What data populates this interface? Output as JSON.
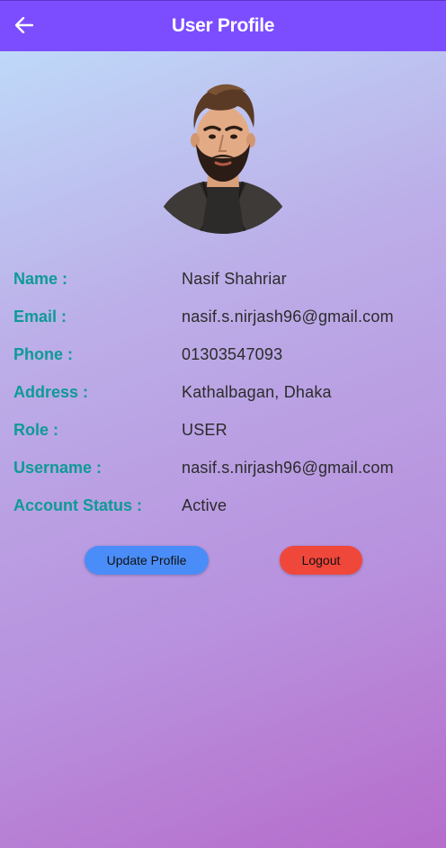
{
  "appbar": {
    "title": "User Profile",
    "back_icon": "arrow-left-icon"
  },
  "avatar": {
    "icon": "bearded-man-illustration"
  },
  "profile": {
    "rows": [
      {
        "label": "Name :",
        "value": "Nasif Shahriar"
      },
      {
        "label": "Email :",
        "value": "nasif.s.nirjash96@gmail.com"
      },
      {
        "label": "Phone :",
        "value": "01303547093"
      },
      {
        "label": "Address :",
        "value": "Kathalbagan, Dhaka"
      },
      {
        "label": "Role :",
        "value": "USER"
      },
      {
        "label": "Username :",
        "value": "nasif.s.nirjash96@gmail.com"
      },
      {
        "label": "Account Status :",
        "value": "Active"
      }
    ]
  },
  "actions": {
    "update_label": "Update Profile",
    "logout_label": "Logout"
  },
  "colors": {
    "appbar": "#7c4dff",
    "label": "#0e9a96",
    "update_button": "#4a8df8",
    "logout_button": "#f0473b"
  }
}
